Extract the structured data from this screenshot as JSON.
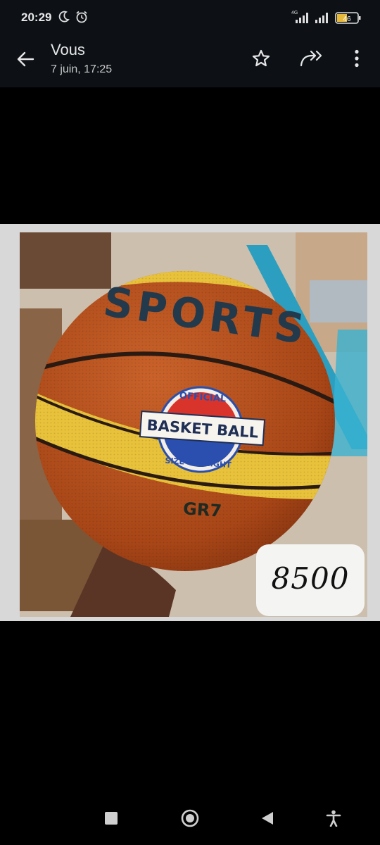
{
  "status_bar": {
    "time": "20:29",
    "network_label": "4G",
    "battery_level": "46"
  },
  "header": {
    "title": "Vous",
    "subtitle": "7 juin, 17:25"
  },
  "image": {
    "ball_text_top": "SPORTS",
    "badge_text": "BASKET BALL",
    "badge_arc_top": "OFFICIAL",
    "badge_arc_bottom": "SIZE & WEIGHT",
    "ball_size_text": "GR7",
    "price": "8500"
  },
  "colors": {
    "bar_background": "#0d1116",
    "ball_orange": "#b5501e",
    "ball_yellow": "#e8c23a"
  }
}
